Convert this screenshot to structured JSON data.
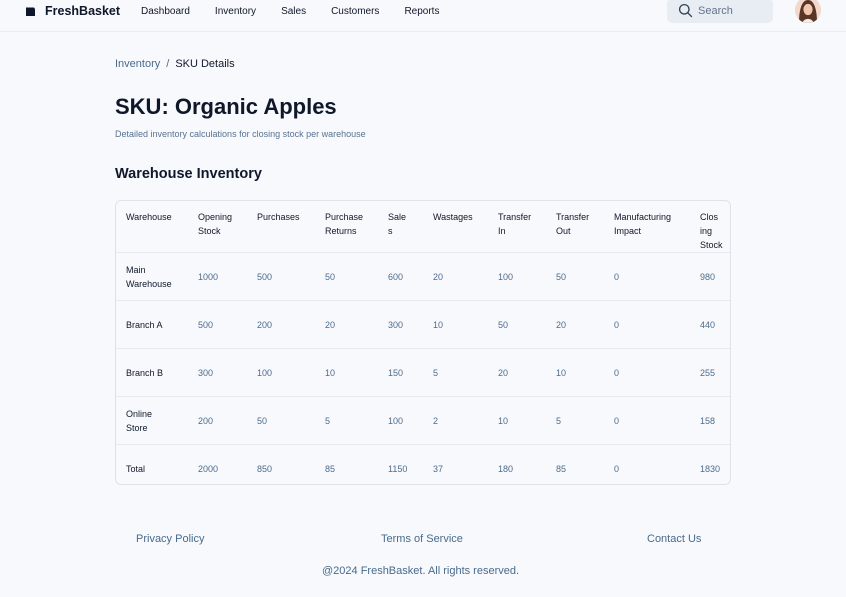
{
  "header": {
    "brand": "FreshBasket",
    "nav": [
      "Dashboard",
      "Inventory",
      "Sales",
      "Customers",
      "Reports"
    ],
    "search_placeholder": "Search"
  },
  "breadcrumb": {
    "parent": "Inventory",
    "separator": "/",
    "current": "SKU Details"
  },
  "page": {
    "title": "SKU: Organic Apples",
    "subtitle": "Detailed inventory calculations for closing stock per warehouse",
    "section_title": "Warehouse Inventory"
  },
  "table": {
    "headers": [
      [
        "Warehouse"
      ],
      [
        "Opening",
        "Stock"
      ],
      [
        "Purchases"
      ],
      [
        "Purchase",
        "Returns"
      ],
      [
        "Sale",
        "s"
      ],
      [
        "Wastages"
      ],
      [
        "Transfer",
        "In"
      ],
      [
        "Transfer",
        "Out"
      ],
      [
        "Manufacturing",
        "Impact"
      ],
      [
        "Clos",
        "ing",
        "Stock"
      ]
    ],
    "rows": [
      [
        [
          "Main",
          "Warehouse"
        ],
        "1000",
        "500",
        "50",
        "600",
        "20",
        "100",
        "50",
        "0",
        "980"
      ],
      [
        [
          "Branch A"
        ],
        "500",
        "200",
        "20",
        "300",
        "10",
        "50",
        "20",
        "0",
        "440"
      ],
      [
        [
          "Branch B"
        ],
        "300",
        "100",
        "10",
        "150",
        "5",
        "20",
        "10",
        "0",
        "255"
      ],
      [
        [
          "Online",
          "Store"
        ],
        "200",
        "50",
        "5",
        "100",
        "2",
        "10",
        "5",
        "0",
        "158"
      ],
      [
        [
          "Total"
        ],
        "2000",
        "850",
        "85",
        "1150",
        "37",
        "180",
        "85",
        "0",
        "1830"
      ]
    ]
  },
  "footer": {
    "links": [
      "Privacy Policy",
      "Terms of Service",
      "Contact Us"
    ],
    "copyright": "@2024 FreshBasket. All rights reserved."
  }
}
